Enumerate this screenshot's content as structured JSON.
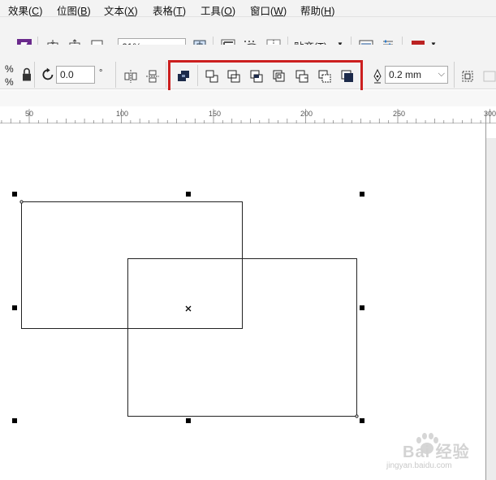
{
  "menubar": {
    "items": [
      {
        "label": "效果(",
        "key": "C",
        "end": ")"
      },
      {
        "label": "位图(",
        "key": "B",
        "end": ")"
      },
      {
        "label": "文本(",
        "key": "X",
        "end": ")"
      },
      {
        "label": "表格(",
        "key": "T",
        "end": ")"
      },
      {
        "label": "工具(",
        "key": "O",
        "end": ")"
      },
      {
        "label": "窗口(",
        "key": "W",
        "end": ")"
      },
      {
        "label": "帮助(",
        "key": "H",
        "end": ")"
      }
    ]
  },
  "toolbar": {
    "zoom_value": "61%",
    "snap_label": "贴齐(T)"
  },
  "property_bar": {
    "scale_symbol_top": "%",
    "scale_symbol_bottom": "%",
    "rotation_value": "0.0",
    "degree_symbol": "°",
    "outline_width": "0.2 mm"
  },
  "ruler": {
    "ticks": [
      "50",
      "100",
      "150",
      "200",
      "250",
      "300"
    ]
  },
  "watermark": {
    "text": "Bai 经验",
    "sub": "jingyan.baidu.com"
  },
  "colors": {
    "highlight": "#cc1f1f",
    "toolbar_bg": "#f3f3f3"
  }
}
